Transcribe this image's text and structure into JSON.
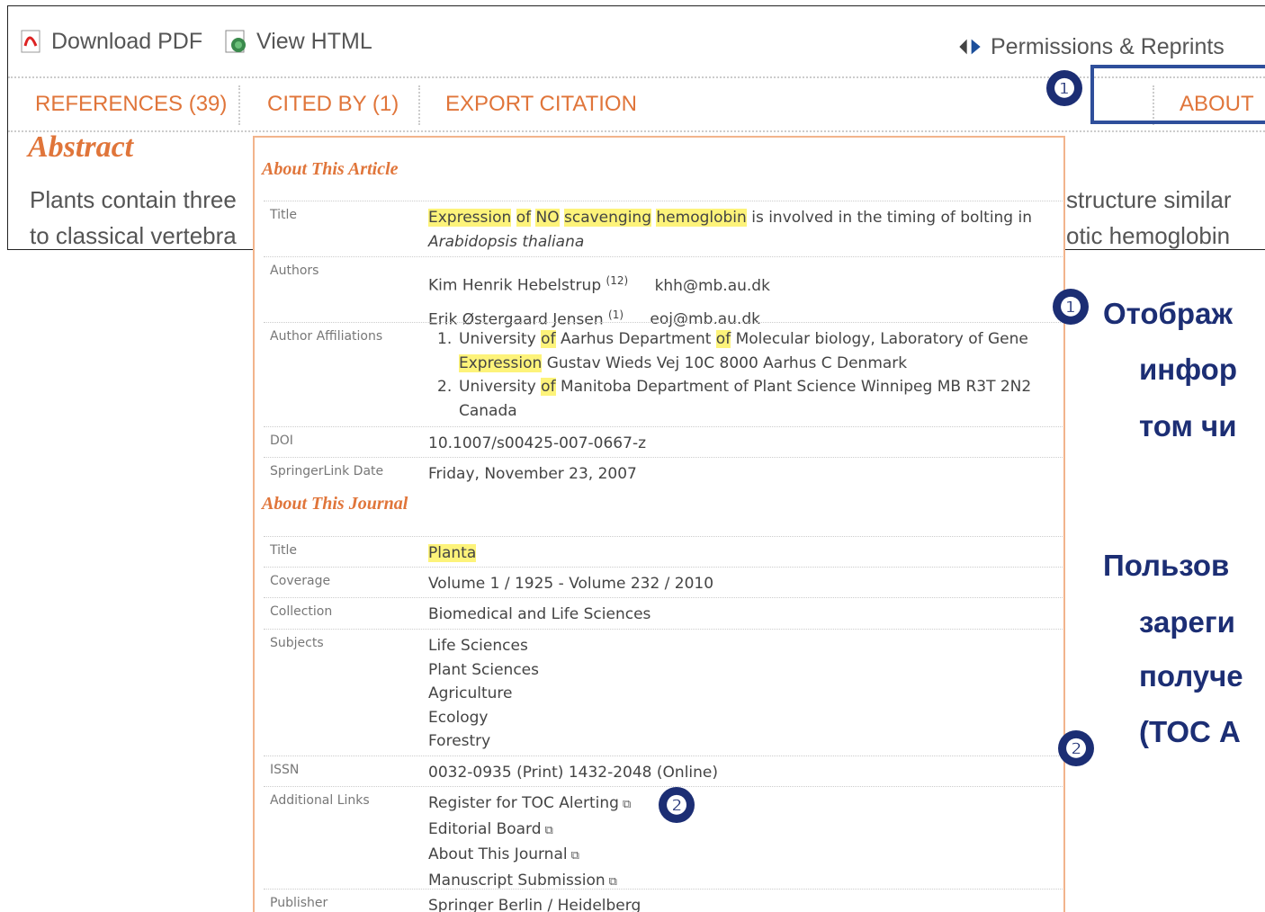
{
  "toolbar": {
    "download_pdf": "Download PDF",
    "view_html": "View HTML",
    "permissions": "Permissions & Reprints"
  },
  "tabs": {
    "references": "REFERENCES (39)",
    "cited_by": "CITED BY (1)",
    "export_citation": "EXPORT CITATION",
    "about": "ABOUT"
  },
  "abstract": {
    "title": "Abstract",
    "line1_left": "Plants contain three",
    "line1_right": "structure similar",
    "line2_left": "to classical vertebra",
    "line2_right": "otic hemoglobin"
  },
  "badges": {
    "one": "❶",
    "two": "❷"
  },
  "article": {
    "section_title": "About This Article",
    "title_label": "Title",
    "title_words": [
      "Expression",
      "of",
      "NO",
      "scavenging",
      "hemoglobin"
    ],
    "title_rest": "is involved in the timing of bolting in",
    "title_species": "Arabidopsis thaliana",
    "authors_label": "Authors",
    "authors": [
      {
        "name": "Kim Henrik Hebelstrup",
        "sup": "(12)",
        "email": "khh@mb.au.dk"
      },
      {
        "name": "Erik Østergaard Jensen",
        "sup": "(1)",
        "email": "eoj@mb.au.dk"
      }
    ],
    "affiliations_label": "Author Affiliations",
    "affiliations": [
      {
        "num": "1.",
        "a": "University",
        "b": "of",
        "c": "Aarhus Department",
        "d": "of",
        "e": "Molecular biology, Laboratory of Gene",
        "f": "Expression",
        "g": "Gustav Wieds Vej 10C 8000 Aarhus C Denmark"
      },
      {
        "num": "2.",
        "a": "University",
        "b": "of",
        "c": "Manitoba Department of Plant Science Winnipeg MB R3T 2N2",
        "d": "Canada"
      }
    ],
    "doi_label": "DOI",
    "doi": "10.1007/s00425-007-0667-z",
    "date_label": "SpringerLink Date",
    "date": "Friday, November 23, 2007"
  },
  "journal": {
    "section_title": "About This Journal",
    "title_label": "Title",
    "title": "Planta",
    "coverage_label": "Coverage",
    "coverage": "Volume 1 / 1925 - Volume 232 / 2010",
    "collection_label": "Collection",
    "collection": "Biomedical and Life Sciences",
    "subjects_label": "Subjects",
    "subjects": [
      "Life Sciences",
      "Plant Sciences",
      "Agriculture",
      "Ecology",
      "Forestry"
    ],
    "issn_label": "ISSN",
    "issn": "0032-0935 (Print) 1432-2048 (Online)",
    "links_label": "Additional Links",
    "links": [
      "Register for TOC Alerting",
      "Editorial Board",
      "About This Journal",
      "Manuscript Submission"
    ],
    "publisher_label": "Publisher",
    "publisher": "Springer Berlin / Heidelberg"
  },
  "annotation": {
    "line1": "Отображ",
    "line2": "инфор",
    "line3": "том чи",
    "line4": "Пользов",
    "line5": "зареги",
    "line6": "получе",
    "line7": "(ТОС А"
  }
}
